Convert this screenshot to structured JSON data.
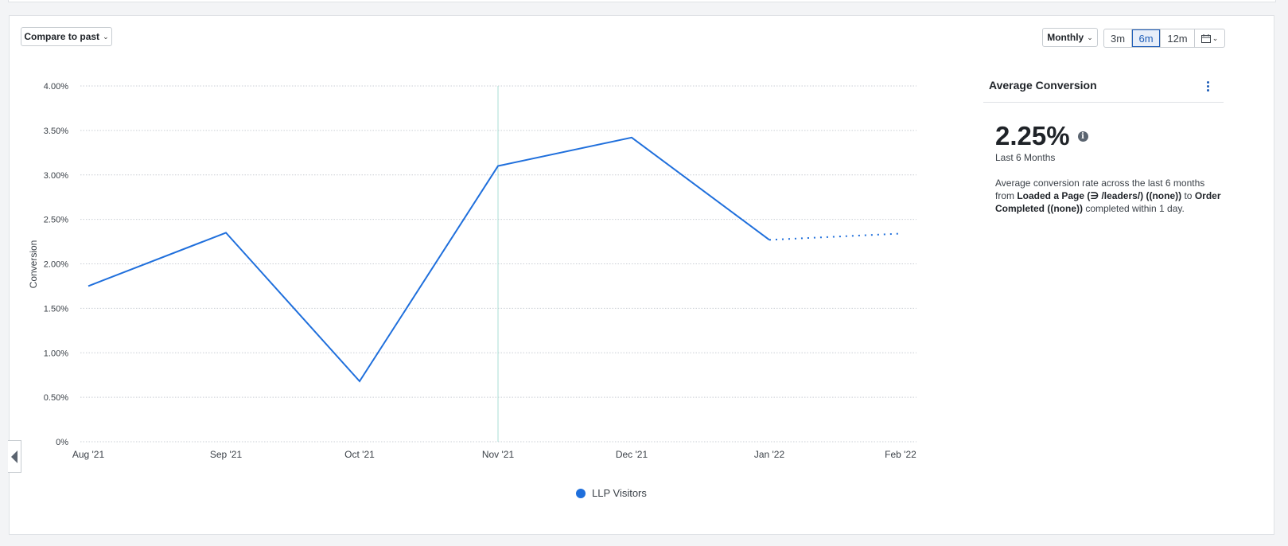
{
  "toolbar": {
    "compare_label": "Compare to past",
    "interval_label": "Monthly",
    "ranges": [
      "3m",
      "6m",
      "12m"
    ],
    "active_range": "6m",
    "calendar_icon": "calendar-icon"
  },
  "chart_data": {
    "type": "line",
    "ylabel": "Conversion",
    "xlabel": "",
    "categories": [
      "Aug '21",
      "Sep '21",
      "Oct '21",
      "Nov '21",
      "Dec '21",
      "Jan '22",
      "Feb '22"
    ],
    "yticks": [
      "0%",
      "0.50%",
      "1.00%",
      "1.50%",
      "2.00%",
      "2.50%",
      "3.00%",
      "3.50%",
      "4.00%"
    ],
    "ylim": [
      0,
      4.0
    ],
    "series": [
      {
        "name": "LLP Visitors",
        "color": "#1f6fdc",
        "values": [
          1.75,
          2.35,
          0.68,
          3.1,
          3.42,
          2.27,
          2.34
        ],
        "incomplete_from_index": 5
      }
    ],
    "highlight_category": "Nov '21",
    "grid": true,
    "legend_position": "bottom"
  },
  "summary": {
    "title": "Average Conversion",
    "value": "2.25%",
    "period": "Last 6 Months",
    "desc_prefix": "Average conversion rate across the last 6 months from ",
    "from_event": "Loaded a Page (∋ /leaders/) ((none))",
    "desc_mid": " to ",
    "to_event": "Order Completed ((none))",
    "desc_suffix": " completed within 1 day."
  }
}
